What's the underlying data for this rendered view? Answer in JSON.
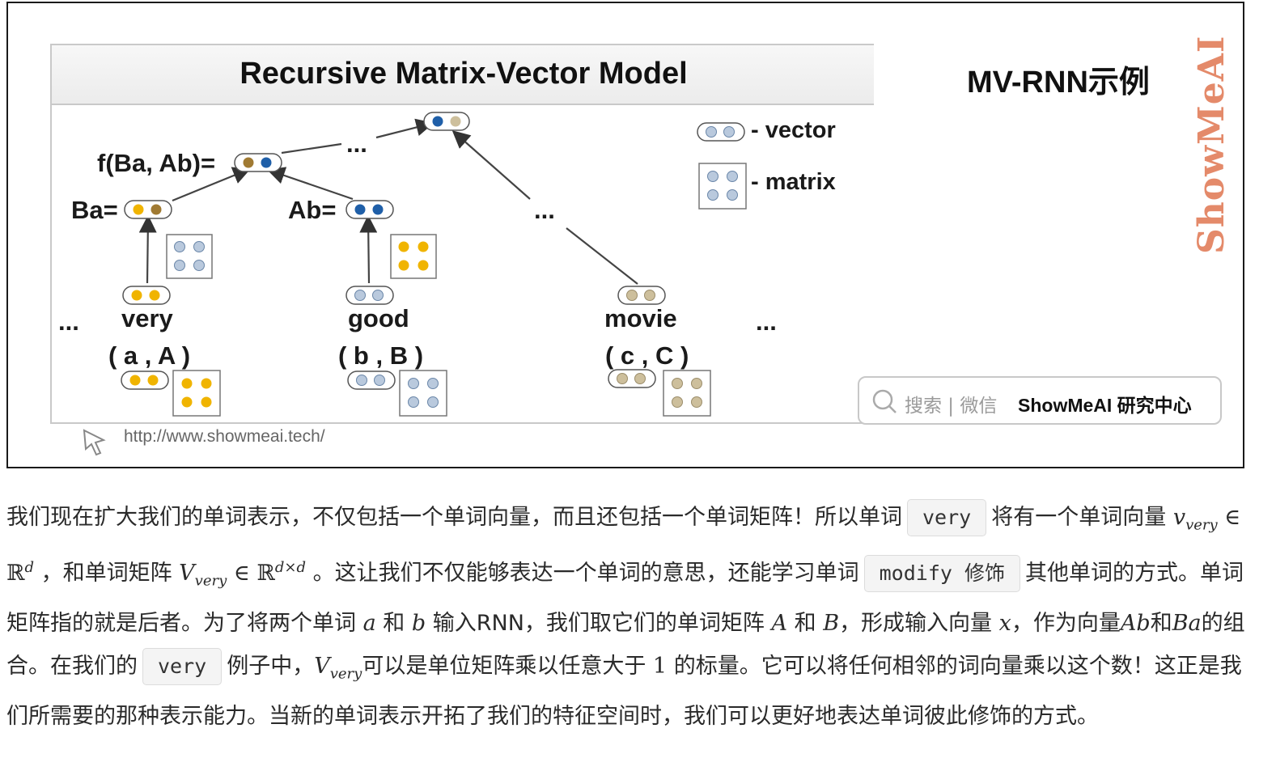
{
  "figure": {
    "diagram_title": "Recursive Matrix-Vector Model",
    "example_title": "MV-RNN示例",
    "brand_watermark": "ShowMeAI",
    "url": "http://www.showmeai.tech/",
    "search_placeholder": "搜索 | 微信",
    "search_brand": "ShowMeAI 研究中心",
    "legend": {
      "vector_label": "- vector",
      "matrix_label": "- matrix"
    },
    "labels": {
      "f": "f(Ba, Ab)=",
      "ba": "Ba=",
      "ab": "Ab=",
      "very": "very",
      "good": "good",
      "movie": "movie",
      "pair_a": "( a , A )",
      "pair_b": "( b , B )",
      "pair_c": "( c , C )",
      "ellipsis": "..."
    },
    "colors": {
      "yellow": "#f0b400",
      "blue": "#1f5fa8",
      "brown": "#a07a32",
      "light": "#b9c9dd",
      "beige": "#cdbf9c"
    }
  },
  "article": {
    "line1_a": "我们现在扩大我们的单词表示，不仅包括一个单词向量，而且还包括一个单词矩阵！所以单词",
    "chip_very": "very",
    "line1_b": "将有一个单词向量",
    "math_v": "v",
    "math_very_sub": "very",
    "math_in": " ∈ ℝ",
    "math_d": "d",
    "line2_a": "，和单词矩阵",
    "math_V": "V",
    "math_dxd": "d×d",
    "line2_b": "。这让我们不仅能够表达一个单词的意思，还能学习单词",
    "chip_modify": "modify 修饰",
    "line3_a": "其他单词的方式。单词矩阵指的就是后者。为了将两个单词",
    "math_a": "a",
    "word_and": "和",
    "math_b": "b",
    "line3_b": "输入RNN，我们取它们的单词矩阵",
    "math_A": "A",
    "math_B": "B",
    "line4_a": "，形成输入向量",
    "math_x": "x",
    "line4_b": "，作为向量",
    "math_Ab": "Ab",
    "math_Ba": "Ba",
    "line4_c": "的组合。在我们的",
    "line4_d": "例子中，",
    "line4_e": "可以是单位矩阵乘以任意大于",
    "math_1": "1",
    "line5_a": "的标量。它可以将任何相邻的词向量乘以这个数！这正是我们所需要的那种表示能力。当新的单词表示开拓了我们的特征空间时，我们可以更好地表达单词彼此修饰的方式。"
  }
}
